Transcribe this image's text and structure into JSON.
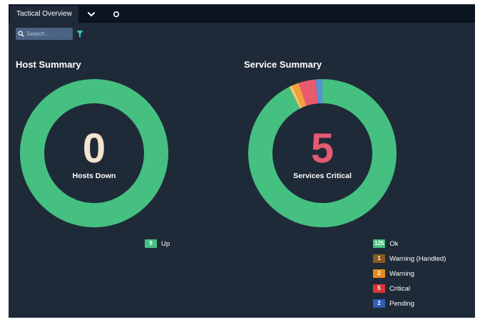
{
  "tabs": {
    "active_label": "Tactical Overview",
    "dropdown_icon": "chevron-down-icon",
    "refresh_icon": "refresh-icon"
  },
  "search": {
    "placeholder": "Search...",
    "icon": "search-icon",
    "filter_icon": "filter-icon"
  },
  "host_summary": {
    "title": "Host Summary",
    "center_value": "0",
    "center_label": "Hosts Down",
    "center_color": "#f2e4cf",
    "segments": [
      {
        "name": "Up",
        "value": 9,
        "color": "#45c081"
      }
    ],
    "legend": [
      {
        "count": "9",
        "label": "Up",
        "color": "#45c081"
      }
    ]
  },
  "service_summary": {
    "title": "Service Summary",
    "center_value": "5",
    "center_label": "Services Critical",
    "center_color": "#e45a71",
    "segments": [
      {
        "name": "Ok",
        "value": 125,
        "color": "#45c081"
      },
      {
        "name": "Warning (Handled)",
        "value": 1,
        "color": "#f5c36a"
      },
      {
        "name": "Warning",
        "value": 2,
        "color": "#f59f3c"
      },
      {
        "name": "Critical",
        "value": 5,
        "color": "#ea5a6e"
      },
      {
        "name": "Pending",
        "value": 2,
        "color": "#5d8ed1"
      }
    ],
    "legend": [
      {
        "count": "125",
        "label": "Ok",
        "color": "#45c081"
      },
      {
        "count": "1",
        "label": "Warning (Handled)",
        "color": "#8a5a1c"
      },
      {
        "count": "2",
        "label": "Warning",
        "color": "#e68a1e"
      },
      {
        "count": "5",
        "label": "Critical",
        "color": "#d93636"
      },
      {
        "count": "2",
        "label": "Pending",
        "color": "#2f5fb8"
      }
    ]
  },
  "colors": {
    "panel_bg": "#1f2a38",
    "tabbar_bg": "#0c1422",
    "donut_hole": "#1f2a38"
  }
}
